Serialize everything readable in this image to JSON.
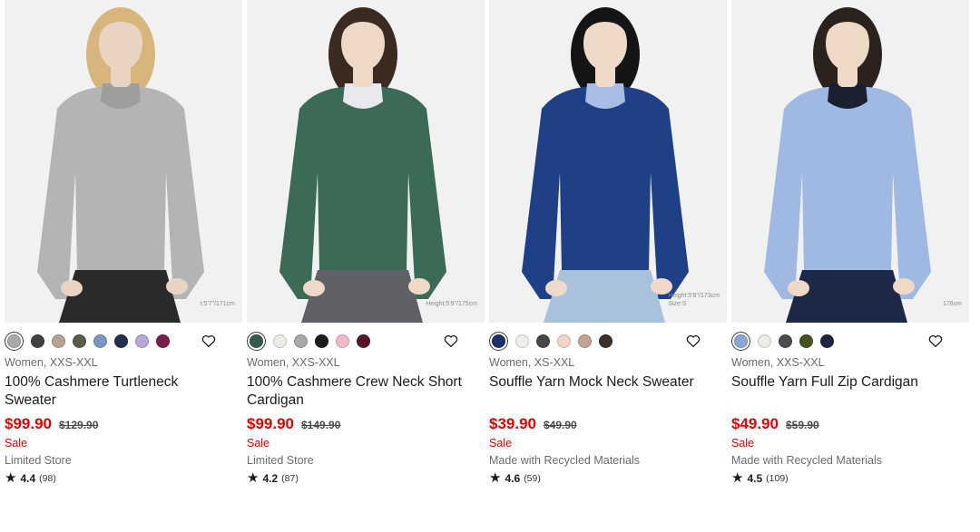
{
  "products": [
    {
      "photo_alt": "",
      "model_note": "t:5'7\"/171cm",
      "swatches": [
        "#a9a9a9",
        "#3f4142",
        "#b5a393",
        "#5a5b4a",
        "#7b95c6",
        "#26304a",
        "#b9a7d8",
        "#7a1d4a"
      ],
      "meta": "Women, XXS-XXL",
      "name": "100% Cashmere Turtleneck Sweater",
      "price": "$99.90",
      "original_price": "$129.90",
      "sale": "Sale",
      "extra": "Limited Store",
      "rating": "4.4",
      "reviews": "(98)"
    },
    {
      "photo_alt": "",
      "model_note": "Height:5'9\"/175cm",
      "swatches": [
        "#355b4c",
        "#ecebe5",
        "#a8a8a8",
        "#1c1c1c",
        "#f3b9c8",
        "#5a1429"
      ],
      "meta": "Women, XXS-XXL",
      "name": "100% Cashmere Crew Neck Short Cardigan",
      "price": "$99.90",
      "original_price": "$149.90",
      "sale": "Sale",
      "extra": "Limited Store",
      "rating": "4.2",
      "reviews": "(87)"
    },
    {
      "photo_alt": "",
      "model_note": "Height:5'8\"/173cm\nSize:S",
      "swatches": [
        "#1c2f6a",
        "#efeee9",
        "#474747",
        "#f1d5c8",
        "#bfa493",
        "#3b3027"
      ],
      "meta": "Women, XS-XXL",
      "name": "Souffle Yarn Mock Neck Sweater",
      "price": "$39.90",
      "original_price": "$49.90",
      "sale": "Sale",
      "extra": "Made with Recycled Materials",
      "rating": "4.6",
      "reviews": "(59)"
    },
    {
      "photo_alt": "",
      "model_note": "176cm",
      "swatches": [
        "#8aa6d6",
        "#ecebe4",
        "#4c4c4c",
        "#45531f",
        "#1c2541"
      ],
      "meta": "Women, XXS-XXL",
      "name": "Souffle Yarn Full Zip Cardigan",
      "price": "$49.90",
      "original_price": "$59.90",
      "sale": "Sale",
      "extra": "Made with Recycled Materials",
      "rating": "4.5",
      "reviews": "(109)"
    }
  ],
  "icons": {
    "favorite": "heart-outline-icon",
    "rating": "star-icon"
  },
  "colors": {
    "sale_red": "#e00000",
    "text": "#1b1b1b",
    "muted": "#6b6b6b"
  },
  "garments": [
    {
      "top": "#b4b4b4",
      "inner": "#9e9e9e",
      "bottom": "#2a2a2a",
      "skin": "#e9d3c3",
      "hair": "#d9b57e"
    },
    {
      "top": "#3b6a57",
      "inner": "#e7e9ee",
      "bottom": "#5f6166",
      "skin": "#eed8c7",
      "hair": "#3a2a20"
    },
    {
      "top": "#1f3f86",
      "inner": "#a9bde6",
      "bottom": "#a9c2dc",
      "skin": "#efd9c9",
      "hair": "#151515"
    },
    {
      "top": "#9fb9e2",
      "inner": "#1b2030",
      "bottom": "#1c2846",
      "skin": "#eed8c6",
      "hair": "#2b221d"
    }
  ]
}
